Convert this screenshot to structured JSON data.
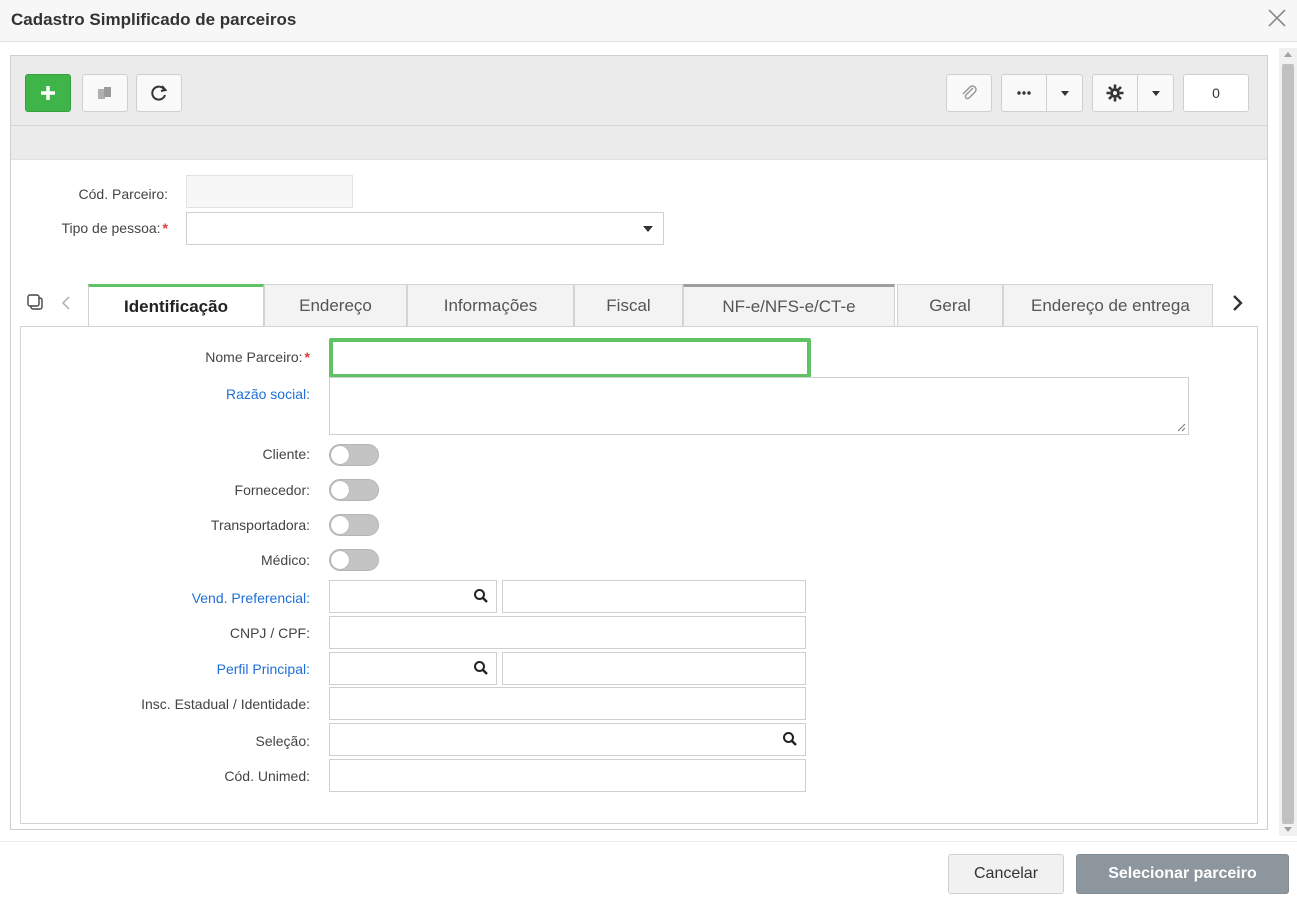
{
  "window": {
    "title": "Cadastro Simplificado de parceiros"
  },
  "toolbar": {
    "counter_value": "0"
  },
  "form": {
    "cod_parceiro_label": "Cód. Parceiro:",
    "tipo_pessoa_label": "Tipo de pessoa:",
    "required_mark": "*"
  },
  "tabs": [
    {
      "label": "Identificação",
      "active": true
    },
    {
      "label": "Endereço"
    },
    {
      "label": "Informações"
    },
    {
      "label": "Fiscal"
    },
    {
      "label": "NF-e/NFS-e/CT-e"
    },
    {
      "label": "Geral"
    },
    {
      "label": "Endereço de entrega"
    }
  ],
  "identificacao": {
    "nome_parceiro": "Nome Parceiro:",
    "razao_social": "Razão social:",
    "cliente": "Cliente:",
    "fornecedor": "Fornecedor:",
    "transportadora": "Transportadora:",
    "medico": "Médico:",
    "vend_preferencial": "Vend. Preferencial:",
    "cnpj_cpf": "CNPJ / CPF:",
    "perfil_principal": "Perfil Principal:",
    "insc_estadual": "Insc. Estadual / Identidade:",
    "selecao": "Seleção:",
    "cod_unimed": "Cód. Unimed:"
  },
  "footer": {
    "cancel_label": "Cancelar",
    "select_label": "Selecionar parceiro"
  },
  "colors": {
    "accent_green": "#3fb449",
    "focus_border": "#5fc366",
    "link_blue": "#1e6fd9",
    "required_red": "#e53935",
    "select_button": "#8d969c"
  }
}
